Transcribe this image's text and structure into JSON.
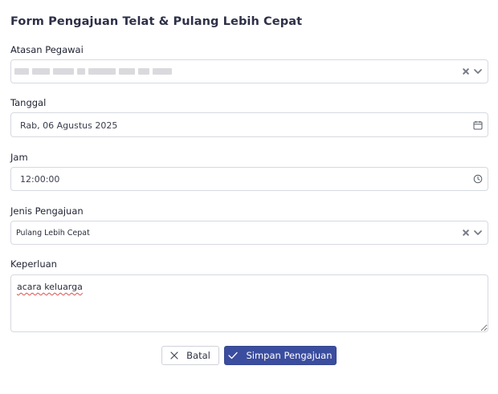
{
  "form": {
    "title": "Form Pengajuan Telat & Pulang Lebih Cepat",
    "atasan": {
      "label": "Atasan Pegawai",
      "value": ""
    },
    "tanggal": {
      "label": "Tanggal",
      "value": "Rab, 06 Agustus 2025"
    },
    "jam": {
      "label": "Jam",
      "value": "12:00:00"
    },
    "jenis": {
      "label": "Jenis Pengajuan",
      "value": "Pulang Lebih Cepat"
    },
    "keperluan": {
      "label": "Keperluan",
      "value": "acara keluarga"
    }
  },
  "actions": {
    "cancel_label": "Batal",
    "save_label": "Simpan Pengajuan"
  },
  "colors": {
    "primary": "#3b4d9e",
    "border": "#d6d9e0",
    "spellcheck": "#d9534f"
  },
  "icons": {
    "clear": "close-icon",
    "dropdown": "chevron-down-icon",
    "date": "calendar-icon",
    "time": "clock-icon",
    "cancel": "close-icon",
    "save": "check-icon"
  }
}
